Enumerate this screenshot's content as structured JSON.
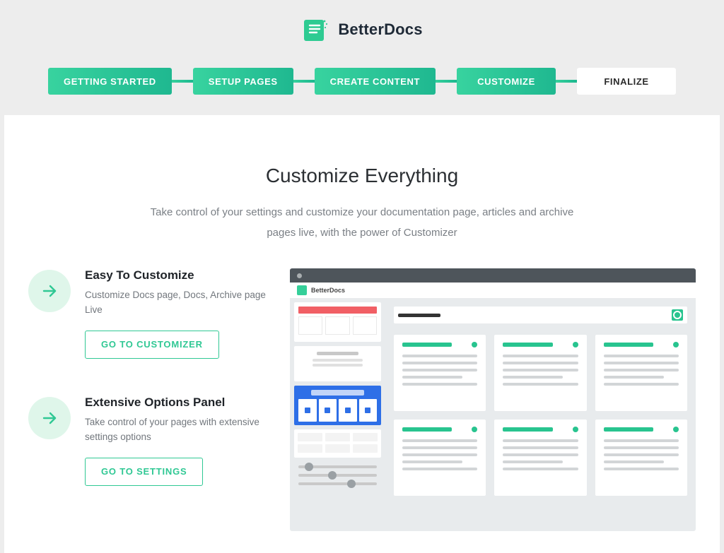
{
  "brand": {
    "name": "BetterDocs"
  },
  "steps": [
    {
      "label": "GETTING STARTED",
      "active": true
    },
    {
      "label": "SETUP PAGES",
      "active": true
    },
    {
      "label": "CREATE CONTENT",
      "active": true
    },
    {
      "label": "CUSTOMIZE",
      "active": true
    },
    {
      "label": "FINALIZE",
      "active": false
    }
  ],
  "page": {
    "title": "Customize Everything",
    "subtitle": "Take control of your settings and customize your documentation page, articles and archive pages live, with the power of Customizer"
  },
  "features": [
    {
      "title": "Easy To Customize",
      "desc": "Customize Docs page, Docs, Archive page Live",
      "button": "GO TO CUSTOMIZER"
    },
    {
      "title": "Extensive Options Panel",
      "desc": "Take control of your pages with extensive settings options",
      "button": "GO TO SETTINGS"
    }
  ],
  "preview": {
    "brand": "BetterDocs"
  },
  "colors": {
    "accent": "#28c48f"
  }
}
